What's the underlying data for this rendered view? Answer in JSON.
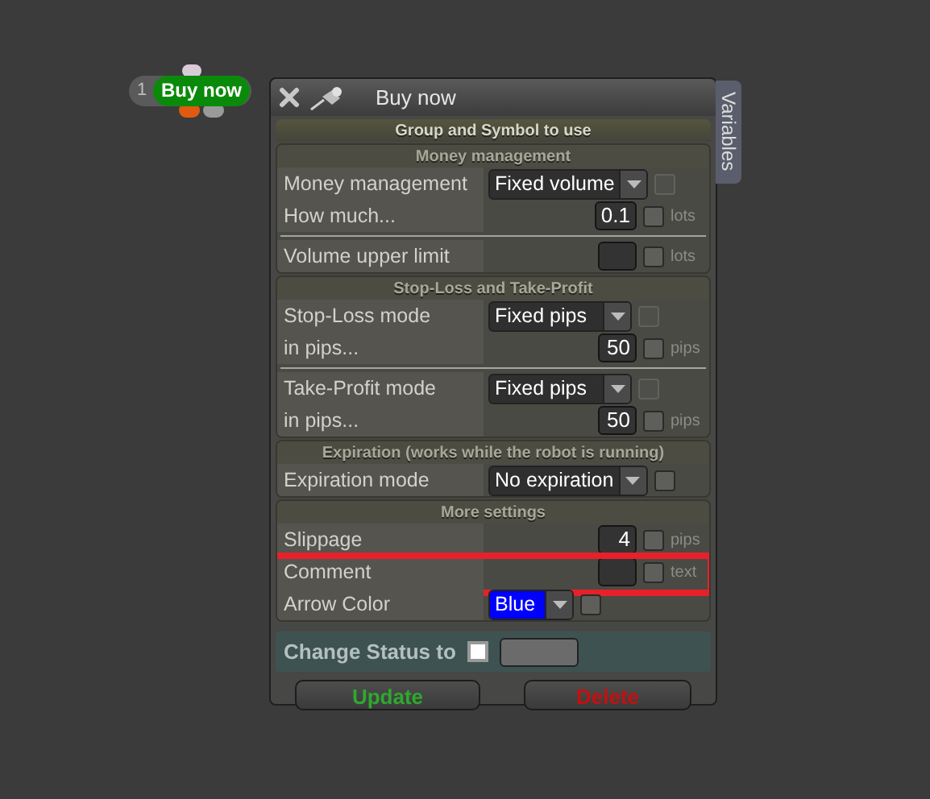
{
  "node": {
    "number": "1",
    "label": "Buy now"
  },
  "window": {
    "title": "Buy now",
    "side_tab": "Variables",
    "group_title": "Group and Symbol to use"
  },
  "sections": [
    {
      "title": "Money management",
      "groups": [
        [
          {
            "label": "Money management",
            "kind": "select",
            "value": "Fixed volume",
            "check": {
              "checked": false,
              "disabled": true
            }
          },
          {
            "label": "How much...",
            "kind": "input",
            "value": "0.1",
            "unit": "lots",
            "check": {
              "checked": false,
              "disabled": false
            }
          }
        ],
        [
          {
            "label": "Volume upper limit",
            "kind": "input",
            "unit": "lots",
            "check": {
              "checked": false,
              "disabled": false
            }
          }
        ]
      ]
    },
    {
      "title": "Stop-Loss and Take-Profit",
      "groups": [
        [
          {
            "label": "Stop-Loss mode",
            "kind": "select",
            "value": "Fixed pips",
            "check": {
              "checked": false,
              "disabled": true
            }
          },
          {
            "label": "in pips...",
            "kind": "input",
            "value": "50",
            "unit": "pips",
            "check": {
              "checked": false,
              "disabled": false
            }
          }
        ],
        [
          {
            "label": "Take-Profit mode",
            "kind": "select",
            "value": "Fixed pips",
            "check": {
              "checked": false,
              "disabled": true
            }
          },
          {
            "label": "in pips...",
            "kind": "input",
            "value": "50",
            "unit": "pips",
            "check": {
              "checked": false,
              "disabled": false
            }
          }
        ]
      ]
    },
    {
      "title": "Expiration (works while the robot is running)",
      "groups": [
        [
          {
            "label": "Expiration mode",
            "kind": "select",
            "value": "No expiration",
            "check": {
              "checked": false,
              "disabled": false
            }
          }
        ]
      ]
    },
    {
      "title": "More settings",
      "groups": [
        [
          {
            "label": "Slippage",
            "kind": "input",
            "value": "4",
            "unit": "pips",
            "check": {
              "checked": false,
              "disabled": false
            }
          },
          {
            "label": "Comment",
            "kind": "input",
            "unit": "text",
            "check": {
              "checked": false,
              "disabled": false
            },
            "highlighted": true
          },
          {
            "label": "Arrow Color",
            "kind": "color",
            "value": "Blue",
            "color": "#0000ff",
            "check": {
              "checked": false,
              "disabled": false
            }
          }
        ]
      ]
    }
  ],
  "status": {
    "label": "Change Status to",
    "checked": false
  },
  "buttons": [
    {
      "label": "Update",
      "kind": "update"
    },
    {
      "label": "Delete",
      "kind": "delete"
    }
  ]
}
